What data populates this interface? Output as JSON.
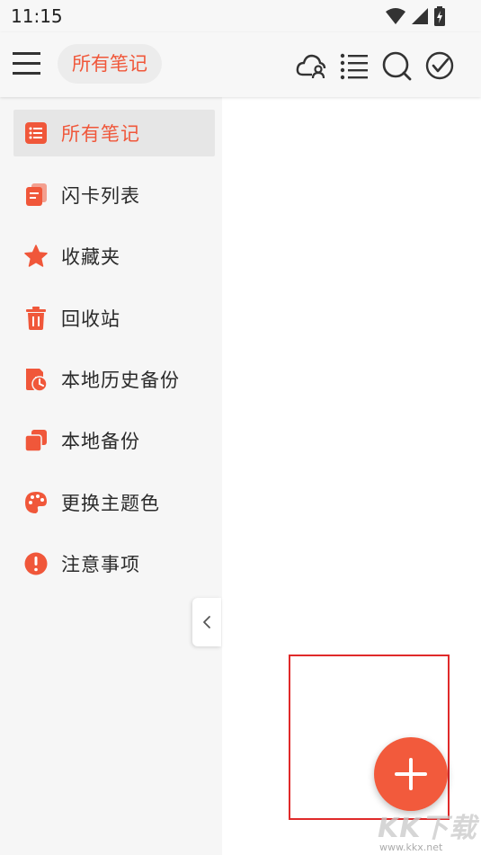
{
  "status_bar": {
    "time": "11:15"
  },
  "app_bar": {
    "title": "所有笔记"
  },
  "sidebar": {
    "items": [
      {
        "label": "所有笔记",
        "icon": "notes-list-icon",
        "active": true
      },
      {
        "label": "闪卡列表",
        "icon": "flashcard-icon",
        "active": false
      },
      {
        "label": "收藏夹",
        "icon": "star-icon",
        "active": false
      },
      {
        "label": "回收站",
        "icon": "trash-icon",
        "active": false
      },
      {
        "label": "本地历史备份",
        "icon": "history-backup-icon",
        "active": false
      },
      {
        "label": "本地备份",
        "icon": "local-backup-icon",
        "active": false
      },
      {
        "label": "更换主题色",
        "icon": "palette-icon",
        "active": false
      },
      {
        "label": "注意事项",
        "icon": "alert-icon",
        "active": false
      }
    ]
  },
  "watermark": {
    "text": "KK下载",
    "url": "www.kkx.net"
  },
  "colors": {
    "accent": "#f25a3c",
    "icon": "#f0573a",
    "highlight_box": "#e02a2a"
  }
}
